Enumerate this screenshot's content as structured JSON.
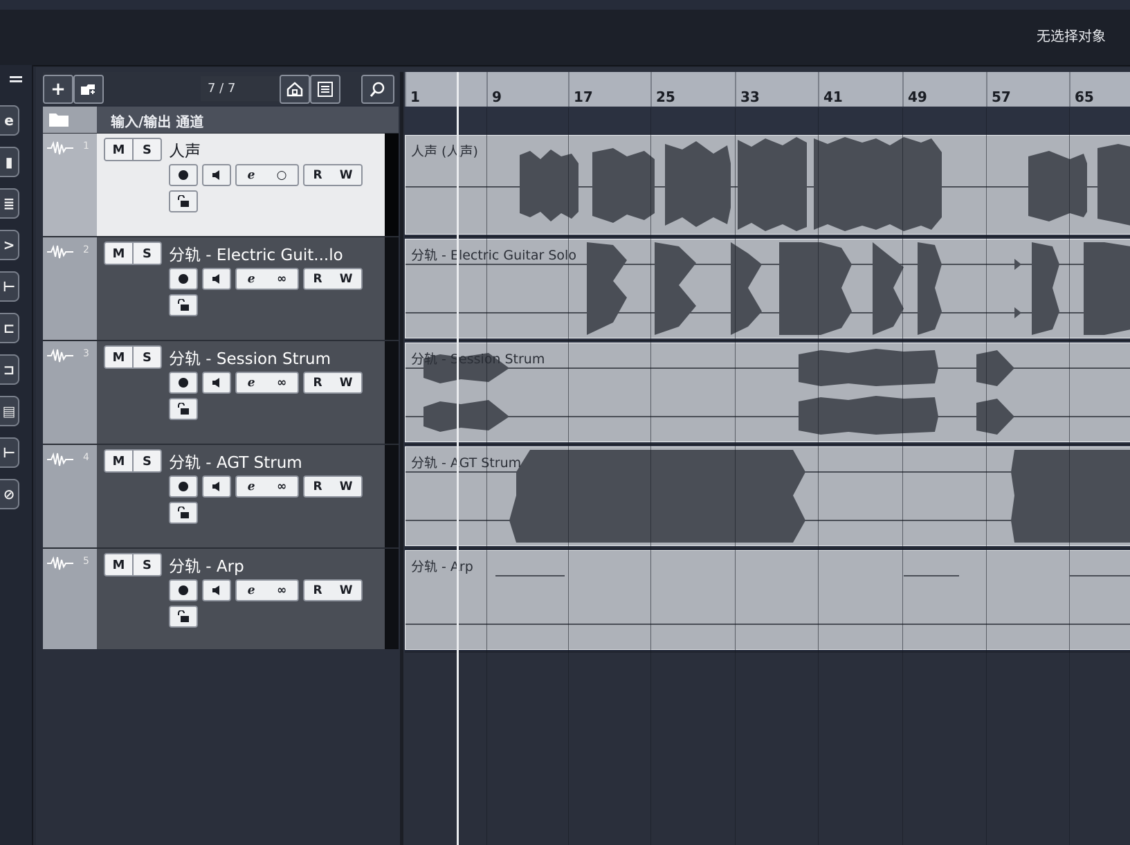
{
  "header": {
    "selection_status": "无选择对象"
  },
  "left_tools": {
    "buttons": [
      "e",
      "▮",
      "≣",
      ">",
      "⊢",
      "⊏",
      "⊐",
      "▤",
      "⊢",
      "⊘"
    ]
  },
  "tracklist_toolbar": {
    "add_label": "+",
    "track_count": "7 / 7",
    "icons": [
      "add-track-icon",
      "folder-add-icon",
      "home-icon",
      "list-icon",
      "search-icon"
    ]
  },
  "io_channel": {
    "label": "输入/输出 通道"
  },
  "ruler": {
    "bars": [
      "1",
      "9",
      "17",
      "25",
      "33",
      "41",
      "49",
      "57",
      "65"
    ]
  },
  "controls": {
    "m": "M",
    "s": "S",
    "r": "R",
    "w": "W"
  },
  "tracks": [
    {
      "number": "1",
      "name": "人声",
      "clip_label": "人声 (人声)",
      "selected": true
    },
    {
      "number": "2",
      "name": "分轨 - Electric Guit...lo",
      "clip_label": "分轨 - Electric Guitar Solo",
      "selected": false
    },
    {
      "number": "3",
      "name": "分轨 - Session Strum",
      "clip_label": "分轨 - Session Strum",
      "selected": false
    },
    {
      "number": "4",
      "name": "分轨 - AGT Strum",
      "clip_label": "分轨 - AGT Strum",
      "selected": false
    },
    {
      "number": "5",
      "name": "分轨 - Arp",
      "clip_label": "分轨 - Arp",
      "selected": false
    }
  ],
  "colors": {
    "selected_track": "#ebecee",
    "track": "#4a4e56",
    "clip": "#aeb2b9",
    "waveform": "#4a4e56",
    "background": "#262b36"
  }
}
